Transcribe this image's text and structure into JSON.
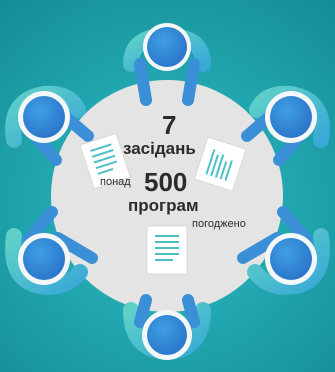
{
  "stats": {
    "meetings_count": "7",
    "meetings_word": "засідань",
    "programs_prefix": "понад",
    "programs_count": "500",
    "programs_word": "програм",
    "programs_suffix": "погоджено"
  },
  "colors": {
    "background": "#22a7b0",
    "table": "#e4e4e4",
    "person_outline": "#3fa0dc",
    "person_head": "#2f7fd3",
    "arm_band": "#4cc3c0",
    "document_line": "#4cc0c6",
    "text": "#2b2b2b"
  },
  "icons": [
    "person-icon",
    "document-icon"
  ]
}
